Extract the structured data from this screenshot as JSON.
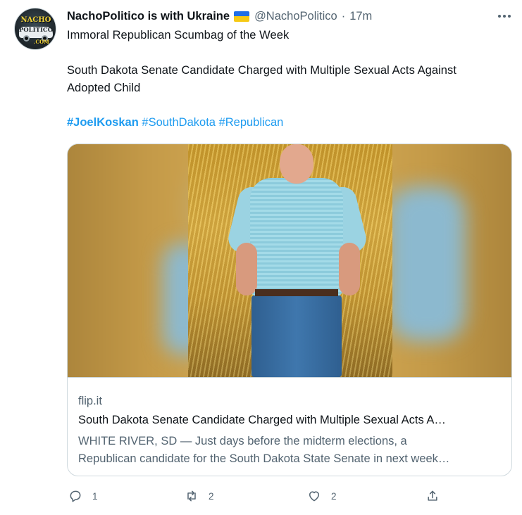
{
  "tweet": {
    "display_name": "NachoPolitico is with Ukraine",
    "flag_icon": "ukraine-flag-icon",
    "handle": "@NachoPolitico",
    "separator": "·",
    "time": "17m",
    "text_line_1": "Immoral Republican Scumbag of the Week",
    "text_line_2": "South Dakota Senate Candidate Charged with Multiple Sexual Acts Against",
    "text_line_3": "Adopted Child",
    "hashtags": [
      "#JoelKoskan",
      "#SouthDakota",
      "#Republican"
    ],
    "avatar_text_1": "NACHO",
    "avatar_text_2": "POLITICO",
    "avatar_text_3": ".COM"
  },
  "card": {
    "domain": "flip.it",
    "title": "South Dakota Senate Candidate Charged with Multiple Sexual Acts A…",
    "desc_line_1": "WHITE RIVER, SD — Just days before the midterm elections, a",
    "desc_line_2": "Republican candidate for the South Dakota State Senate in next week…"
  },
  "actions": {
    "reply_count": "1",
    "retweet_count": "2",
    "like_count": "2"
  },
  "colors": {
    "link": "#1d9bf0",
    "secondary_text": "#536471",
    "primary_text": "#0f1419",
    "border": "#cfd9de"
  }
}
